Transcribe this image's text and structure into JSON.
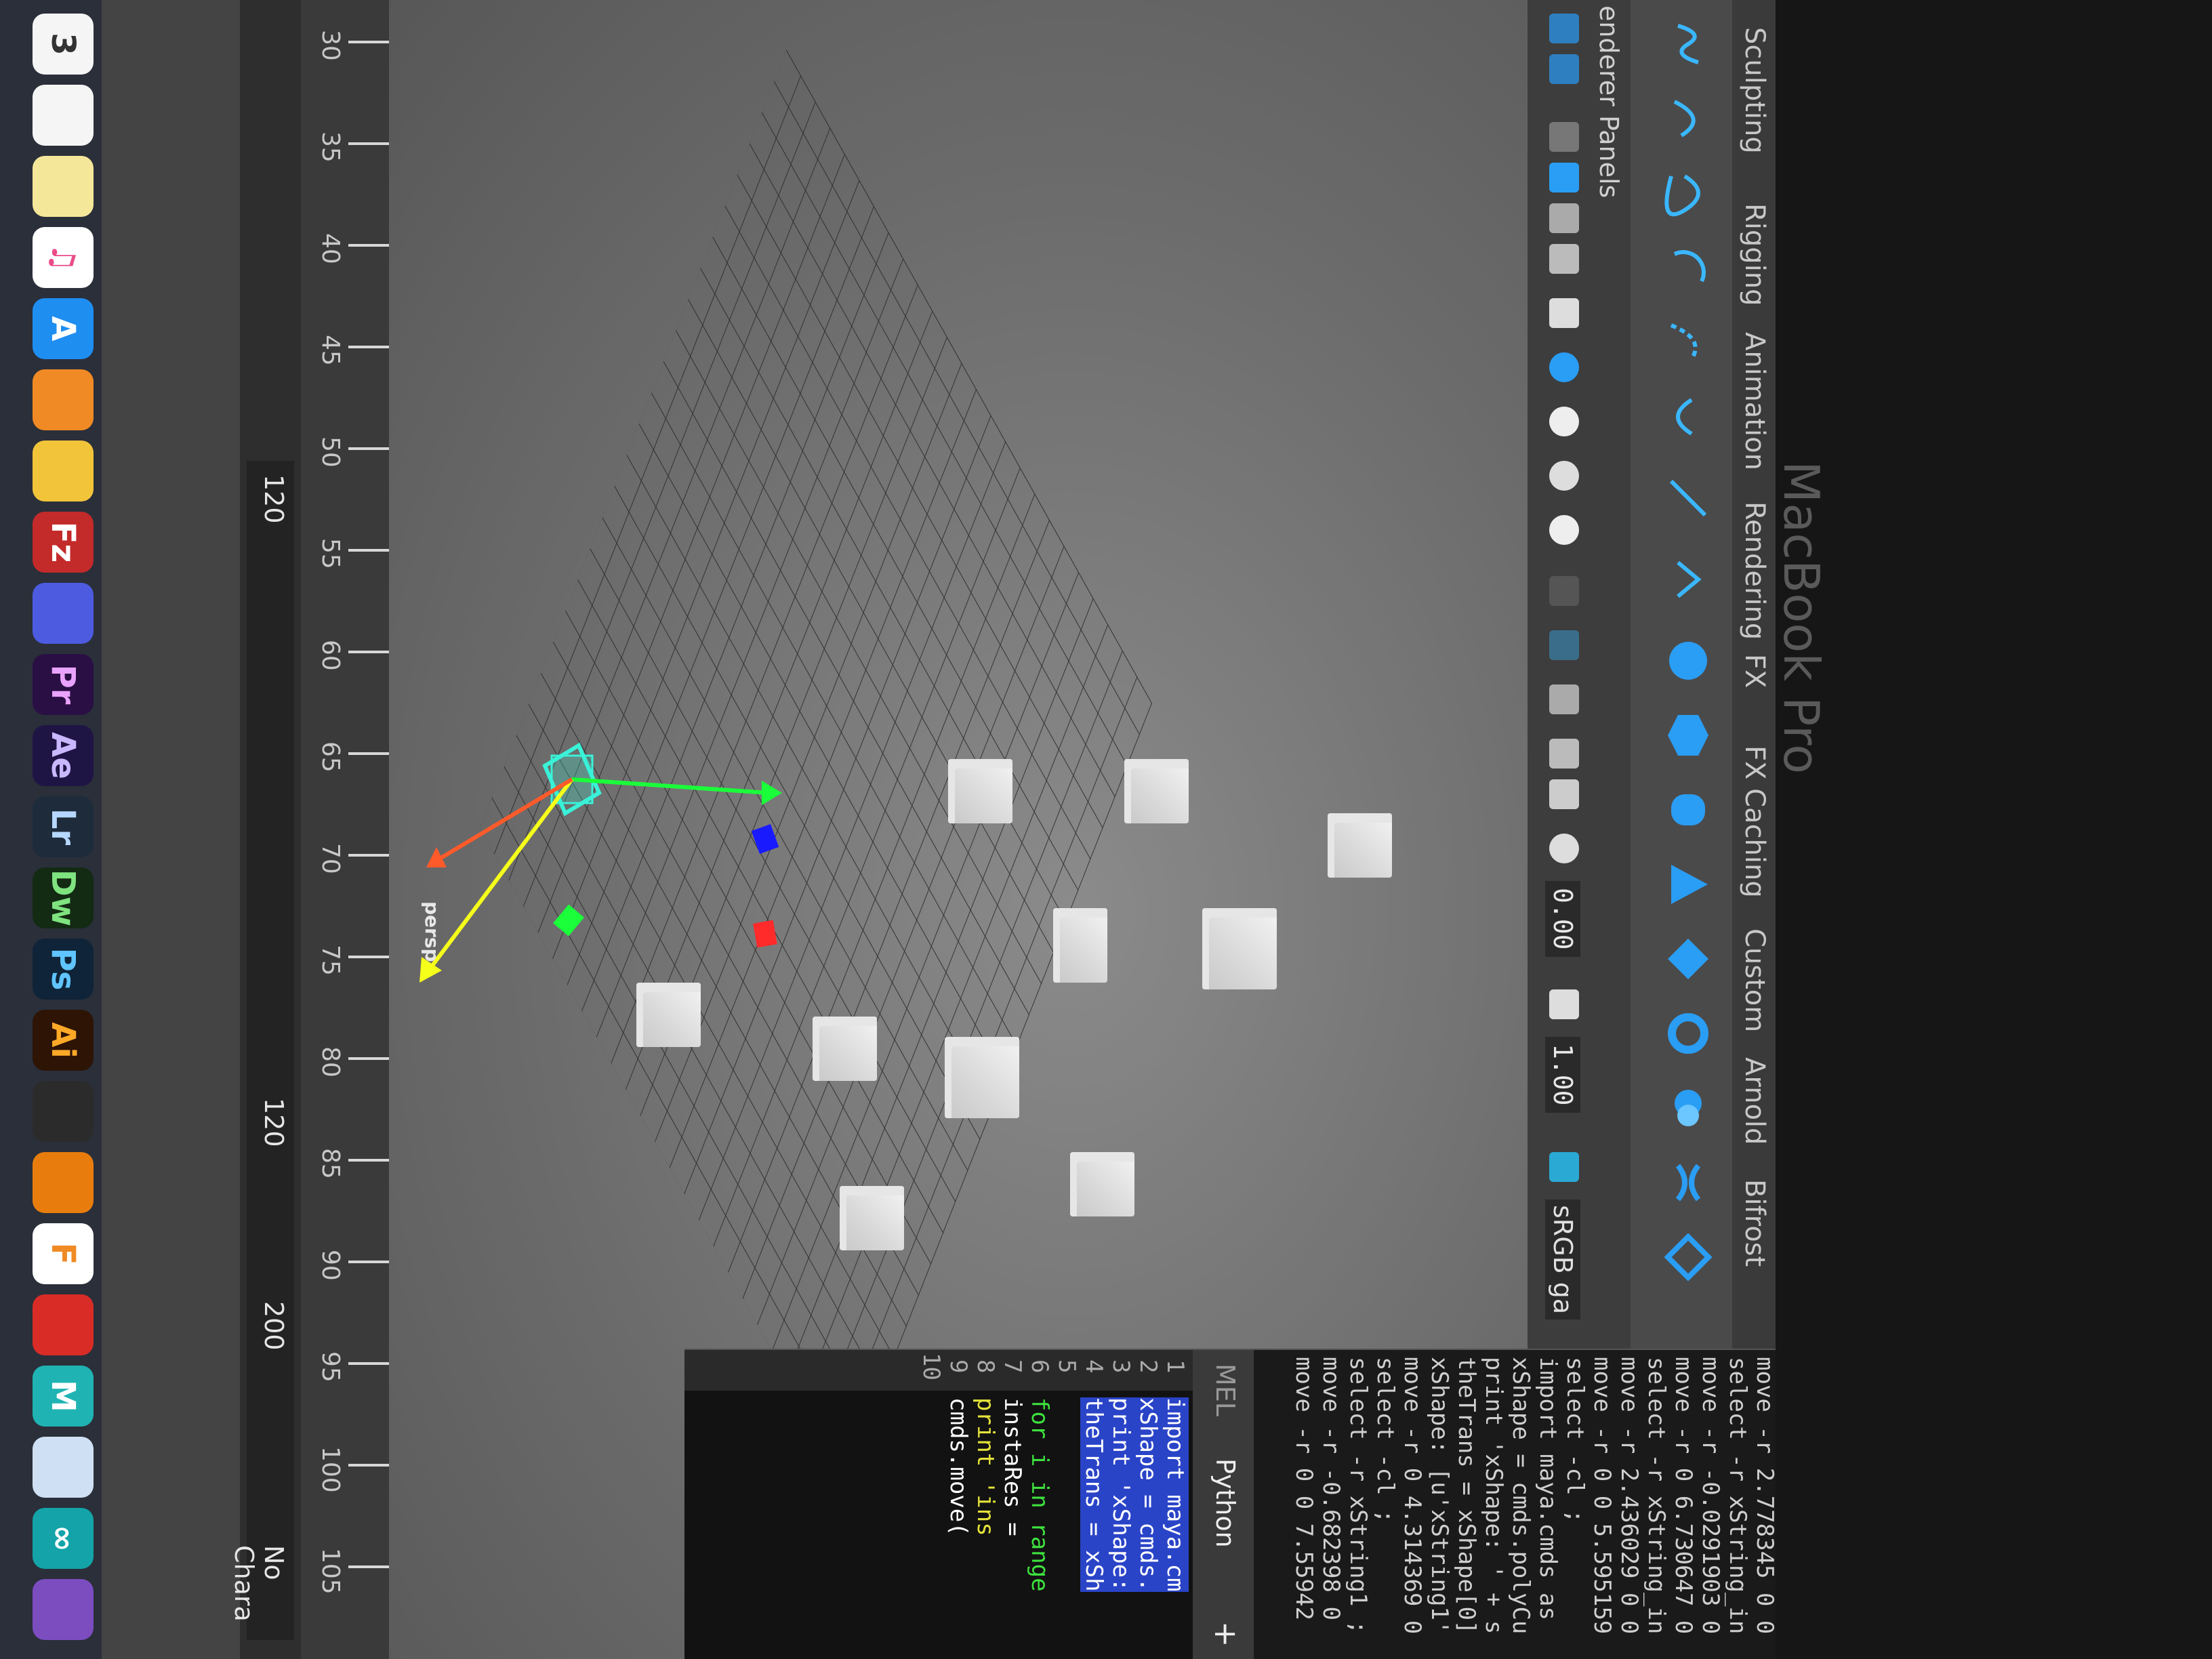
{
  "shelf_tabs": [
    "Sculpting",
    "Rigging",
    "Animation",
    "Rendering",
    "FX",
    "FX Caching",
    "Custom",
    "Arnold",
    "Bifrost"
  ],
  "panel_menus": [
    "enderer",
    "Panels"
  ],
  "toolbar": {
    "value_a": "0.00",
    "value_b": "1.00",
    "colorspace": "sRGB ga"
  },
  "viewport": {
    "camera_label": "persp"
  },
  "script_editor": {
    "tabs": {
      "mel": "MEL",
      "python": "Python",
      "add": "+"
    },
    "history": [
      "move -r 2.778345 0 0",
      "select -r xString_in",
      "move -r -0.0291903 0",
      "move -r 0 6.730647 0",
      "select -r xString_in",
      "move -r 2.436029 0 0",
      "move -r 0 0 5.595159",
      "select -cl ;",
      "import maya.cmds as",
      "xShape = cmds.polyCu",
      "print 'xShape: ' + s",
      "theTrans = xShape[0]",
      "xShape: [u'xString1'",
      "move -r 0 4.314369 0",
      "select -cl ;",
      "select -r xString1 ;",
      "move -r -0.682398 0",
      "move -r 0 0 7.55942"
    ],
    "line_numbers": [
      "1",
      "2",
      "3",
      "4",
      "5",
      "6",
      "7",
      "8",
      "9",
      "10"
    ],
    "code": [
      "import maya.cm",
      "xShape = cmds.",
      "print 'xShape:",
      "theTrans = xSh",
      "",
      "for i in range",
      "    instaRes =",
      "    print 'ins",
      "    cmds.move(",
      ""
    ]
  },
  "timeline": {
    "ticks": [
      "30",
      "35",
      "40",
      "45",
      "50",
      "55",
      "60",
      "65",
      "70",
      "75",
      "80",
      "85",
      "90",
      "95",
      "100",
      "105"
    ],
    "range_start": "120",
    "range_end_a": "120",
    "range_end_b": "200",
    "character_set": "No Chara"
  },
  "dock_apps": [
    {
      "name": "calendar",
      "label": "3",
      "color": "#e44"
    },
    {
      "name": "notes",
      "label": "",
      "color": "#f5f5f5"
    },
    {
      "name": "script",
      "label": "",
      "color": "#f4e79a"
    },
    {
      "name": "itunes",
      "label": "♫",
      "color": "#ea4c89"
    },
    {
      "name": "appstore",
      "label": "A",
      "color": "#1f8ef1"
    },
    {
      "name": "ibooks",
      "label": "",
      "color": "#f08a24"
    },
    {
      "name": "cyberduck",
      "label": "",
      "color": "#f2c43a"
    },
    {
      "name": "filezilla",
      "label": "Fz",
      "color": "#c32a2a"
    },
    {
      "name": "gradient",
      "label": "",
      "color": "#4d5be0"
    },
    {
      "name": "premiere",
      "label": "Pr",
      "color": "#2a0f44"
    },
    {
      "name": "aftereffects",
      "label": "Ae",
      "color": "#1f1545"
    },
    {
      "name": "lightroom",
      "label": "Lr",
      "color": "#1d2b3b"
    },
    {
      "name": "dreamweaver",
      "label": "Dw",
      "color": "#132a13"
    },
    {
      "name": "photoshop",
      "label": "Ps",
      "color": "#0f2438"
    },
    {
      "name": "illustrator",
      "label": "Ai",
      "color": "#2d1405"
    },
    {
      "name": "finalcut",
      "label": "",
      "color": "#2b2b2b"
    },
    {
      "name": "blender",
      "label": "",
      "color": "#e87d0d"
    },
    {
      "name": "fontlab",
      "label": "F",
      "color": "#ffffff"
    },
    {
      "name": "acrobat",
      "label": "",
      "color": "#d92c27"
    },
    {
      "name": "maya",
      "label": "M",
      "color": "#20b3b3"
    },
    {
      "name": "cube-app",
      "label": "",
      "color": "#cfe0f4"
    },
    {
      "name": "arduino",
      "label": "∞",
      "color": "#13a3a8"
    },
    {
      "name": "visualstudio",
      "label": "",
      "color": "#7b4dbf"
    }
  ],
  "hardware": {
    "model": "MacBook Pro"
  }
}
